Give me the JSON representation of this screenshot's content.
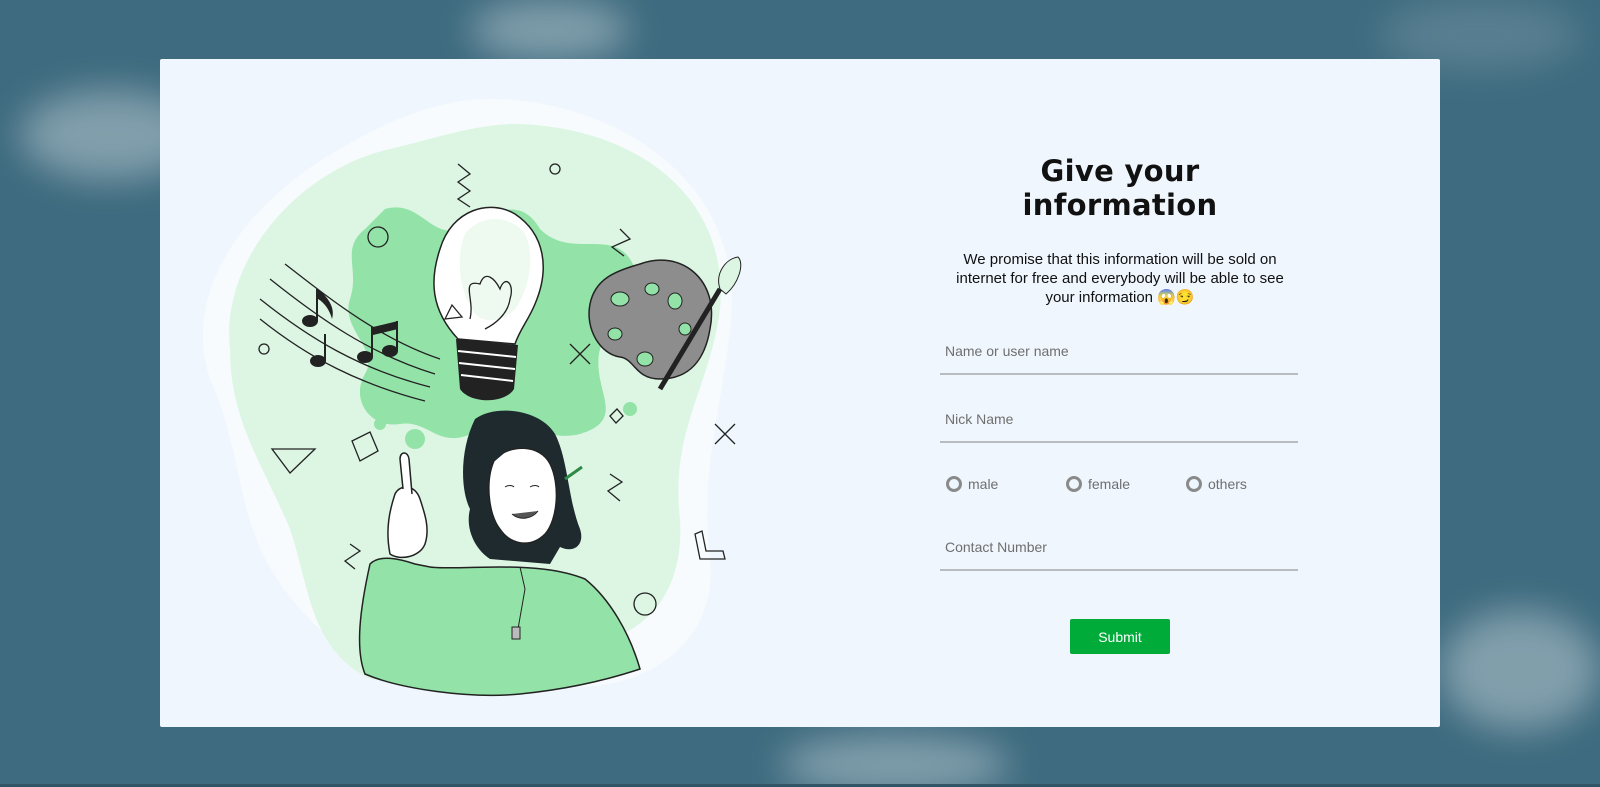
{
  "form": {
    "title": "Give your information",
    "description": "We promise that this information will be sold on internet for free and everybody will be able to see your information 😱😏",
    "fields": {
      "name_placeholder": "Name or user name",
      "nickname_placeholder": "Nick Name",
      "contact_placeholder": "Contact Number"
    },
    "gender_options": [
      "male",
      "female",
      "others"
    ],
    "submit_label": "Submit"
  },
  "colors": {
    "accent_green": "#00ab3a",
    "card_background": "#eff6fd",
    "page_background": "#3e6b7f",
    "illustration_green": "#93e3a8"
  },
  "icons": {
    "illustration": "woman-with-idea-illustration",
    "lightbulb": "lightbulb-icon",
    "music": "music-notes-icon",
    "palette": "paint-palette-icon"
  }
}
